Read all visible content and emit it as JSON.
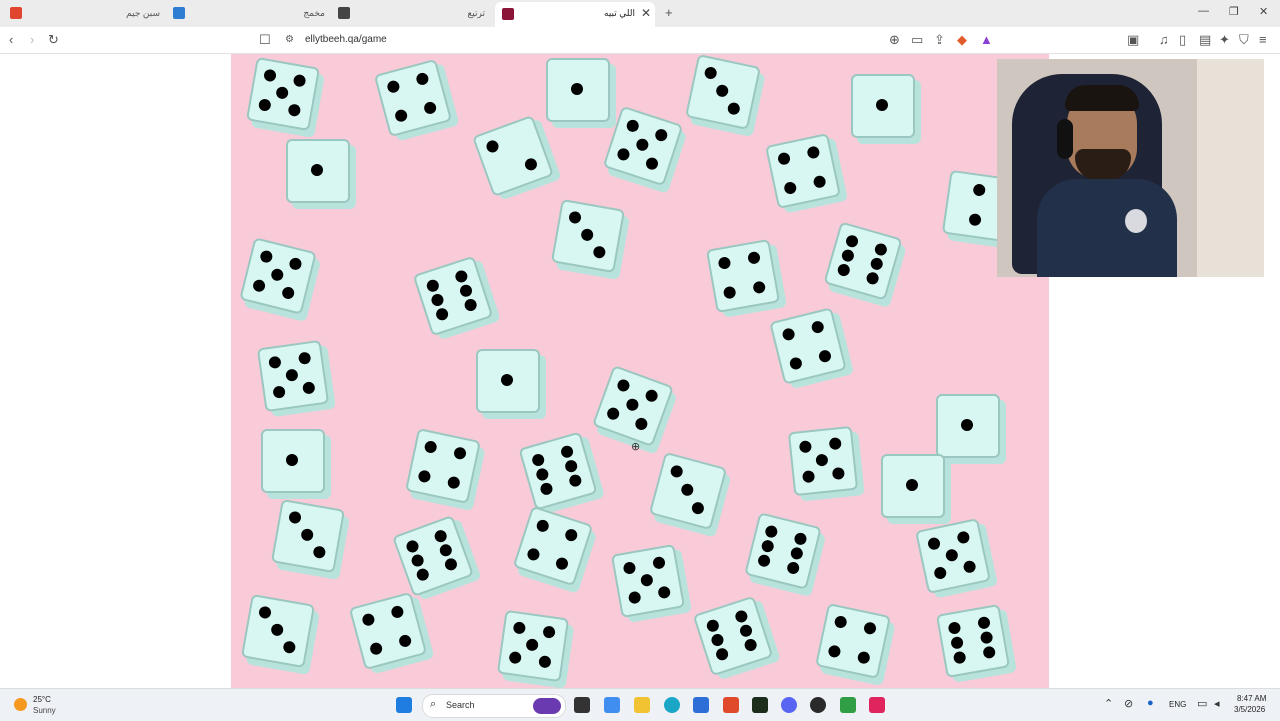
{
  "browser": {
    "tabs": [
      {
        "label": "سبن جيم"
      },
      {
        "label": "مخمج"
      },
      {
        "label": "ترتيع"
      },
      {
        "label": "اللي تبيه"
      }
    ],
    "address": "ellytbeeh.qa/game"
  },
  "taskbar": {
    "weather_temp": "25°C",
    "weather_desc": "Sunny",
    "search_placeholder": "Search",
    "language": "ENG",
    "time": "8:47 AM",
    "date": "3/5/2026"
  },
  "colors": {
    "game_background": "#f9cbd8",
    "die_face": "#d9f7f2",
    "die_edge": "#9ac7c0"
  }
}
